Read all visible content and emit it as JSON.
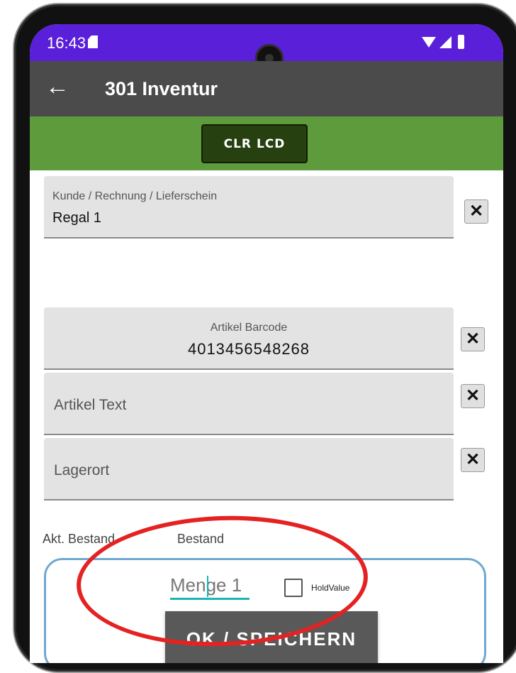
{
  "status_bar": {
    "time": "16:43",
    "icons": [
      "sd-card-icon",
      "wifi-icon",
      "signal-icon",
      "battery-icon"
    ],
    "color": "#5a1fd8"
  },
  "app_bar": {
    "back_icon": "←",
    "title": "301 Inventur",
    "color": "#4b4b4b"
  },
  "toolbar": {
    "clr_label": "CLR LCD",
    "color": "#5e9b3c"
  },
  "fields": {
    "customer": {
      "label": "Kunde / Rechnung / Lieferschein",
      "value": "Regal 1"
    },
    "barcode": {
      "label": "Artikel Barcode",
      "value": "4013456548268"
    },
    "article_text": {
      "placeholder": "Artikel Text",
      "value": ""
    },
    "location": {
      "placeholder": "Lagerort",
      "value": ""
    }
  },
  "clear_symbol": "✕",
  "stock": {
    "current_label": "Akt. Bestand",
    "stock_label": "Bestand"
  },
  "quantity": {
    "placeholder": "Menge 1",
    "hold_label": "HoldValue",
    "hold_checked": false,
    "ok_label": "OK / SPEICHERN"
  }
}
